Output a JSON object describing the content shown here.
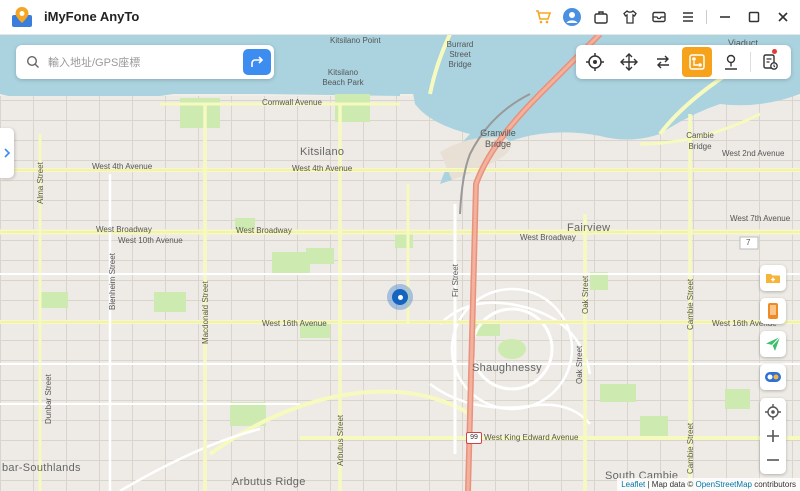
{
  "app": {
    "title": "iMyFone AnyTo"
  },
  "search": {
    "placeholder": "輸入地址/GPS座標"
  },
  "map": {
    "labels": {
      "kitsilano": "Kitsilano",
      "kitsilano_point": "Kitsilano Point",
      "kitsilano_beach_park": "Kitsilano Beach Park",
      "fairview": "Fairview",
      "shaughnessy": "Shaughnessy",
      "arbutus_ridge": "Arbutus Ridge",
      "south_cambie": "South Cambie",
      "bar_southlands": "bar-Southlands",
      "viaduct": "Viaduct",
      "burrard_bridge": "Burrard Street Bridge",
      "granville_bridge": "Granville Bridge",
      "cambie_bridge": "Cambie Bridge",
      "cornwall": "Cornwall Avenue",
      "w4th_a": "West 4th Avenue",
      "w4th_b": "West 4th Avenue",
      "w2nd": "West 2nd Avenue",
      "w7th": "West 7th Avenue",
      "broadway_a": "West Broadway",
      "broadway_b": "West Broadway",
      "broadway_c": "West Broadway",
      "w10th": "West 10th Avenue",
      "w16th_a": "West 16th Avenue",
      "w16th_b": "West 16th Avenue",
      "king_edward": "West King Edward Avenue",
      "alma": "Alma Street",
      "blenheim": "Blenheim Street",
      "macdonald": "Macdonald Street",
      "dunbar": "Dunbar Street",
      "arbutus": "Arbutus Street",
      "fir": "Fir Street",
      "oak_a": "Oak Street",
      "oak_b": "Oak Street",
      "cambie": "Cambie Street",
      "cambie_b": "Cambie Street",
      "hwy99": "99",
      "hwy7": "7"
    }
  },
  "attribution": {
    "leaflet": "Leaflet",
    "sep": " | Map data © ",
    "osm": "OpenStreetMap",
    "contrib": " contributors"
  },
  "colors": {
    "accent": "#3d8cf0",
    "mode_active": "#f7a21b",
    "marker": "#1565c0"
  },
  "icons": {
    "titlebar": [
      "cart-icon",
      "user-icon",
      "briefcase-icon",
      "shirt-icon",
      "mail-icon",
      "menu-icon",
      "minimize-icon",
      "maximize-icon",
      "close-icon"
    ],
    "modes": [
      "teleport-icon",
      "joystick-icon",
      "two-spot-icon",
      "multi-spot-icon",
      "jump-teleport-icon",
      "history-icon"
    ],
    "right": [
      "saved-folder-icon",
      "device-icon",
      "send-location-icon",
      "toggle-icon",
      "locate-icon",
      "zoom-in-icon",
      "zoom-out-icon"
    ]
  }
}
